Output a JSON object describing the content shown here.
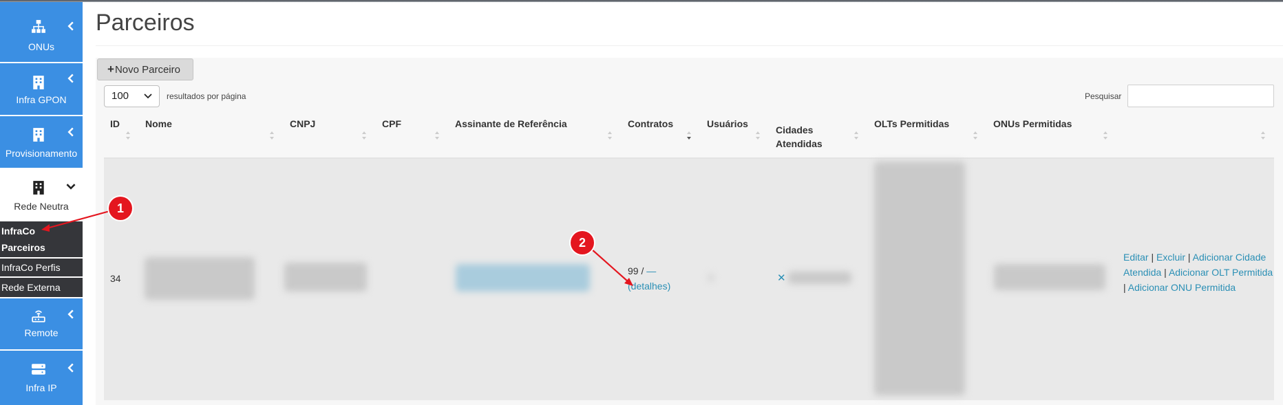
{
  "sidebar": {
    "items": [
      {
        "label": "ONUs",
        "icon": "network-icon"
      },
      {
        "label": "Infra GPON",
        "icon": "building-icon"
      },
      {
        "label": "Provisionamento",
        "icon": "building-icon"
      },
      {
        "label": "Rede Neutra",
        "icon": "building-dark-icon"
      },
      {
        "label": "Remote",
        "icon": "router-icon"
      },
      {
        "label": "Infra IP",
        "icon": "server-icon"
      }
    ],
    "subitems": [
      {
        "label_line1": "InfraCo",
        "label_line2": "Parceiros"
      },
      {
        "label": "InfraCo Perfis"
      },
      {
        "label": "Rede Externa"
      }
    ]
  },
  "page": {
    "title": "Parceiros",
    "new_button": "Novo Parceiro",
    "length_value": "100",
    "length_label": "resultados por página",
    "search_label": "Pesquisar",
    "search_value": ""
  },
  "table": {
    "headers": {
      "id": "ID",
      "nome": "Nome",
      "cnpj": "CNPJ",
      "cpf": "CPF",
      "assinante": "Assinante de Referência",
      "contratos": "Contratos",
      "usuarios": "Usuários",
      "cidades_1": "Cidades",
      "cidades_2": "Atendidas",
      "olts": "OLTs Permitidas",
      "onus": "ONUs Permitidas"
    },
    "row": {
      "id": "34",
      "contratos_count": "99 /",
      "contratos_dash": "—",
      "contratos_detalhes": "(detalhes)",
      "cidade_remove": "✕"
    },
    "actions": {
      "editar": "Editar",
      "sep": " | ",
      "excluir": "Excluir",
      "adicionar_cidade": "Adicionar Cidade Atendida",
      "adicionar_olt": "Adicionar OLT Permitida",
      "adicionar_onu": "Adicionar ONU Permitida"
    }
  },
  "annotations": {
    "step1": "1",
    "step2": "2"
  },
  "colors": {
    "nav_blue": "#3b8fe3",
    "submenu_dark": "#35363a",
    "link": "#2a8fb5",
    "annotation_red": "#e4161f"
  }
}
